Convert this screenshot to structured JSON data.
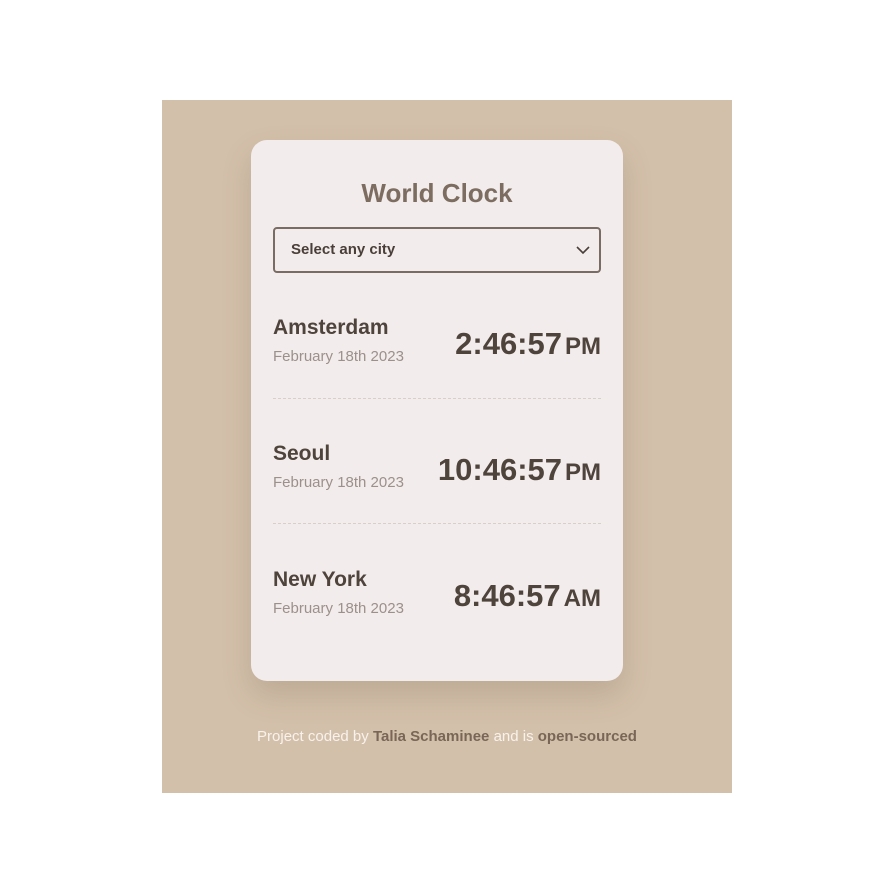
{
  "title": "World Clock",
  "select": {
    "label": "Select any city",
    "icon": "chevron-down-icon"
  },
  "cities": [
    {
      "name": "Amsterdam",
      "date": "February 18th 2023",
      "time": "2:46:57",
      "ampm": "PM"
    },
    {
      "name": "Seoul",
      "date": "February 18th 2023",
      "time": "10:46:57",
      "ampm": "PM"
    },
    {
      "name": "New York",
      "date": "February 18th 2023",
      "time": "8:46:57",
      "ampm": "AM"
    }
  ],
  "footer": {
    "prefix": "Project coded by",
    "author": "Talia Schaminee",
    "middle": "and is",
    "link": "open-sourced"
  },
  "colors": {
    "backdrop": "#d3c0aa",
    "card": "#f2ecec",
    "text_dark": "#4f443c",
    "title": "#7d6d60",
    "muted": "#9c918a"
  }
}
